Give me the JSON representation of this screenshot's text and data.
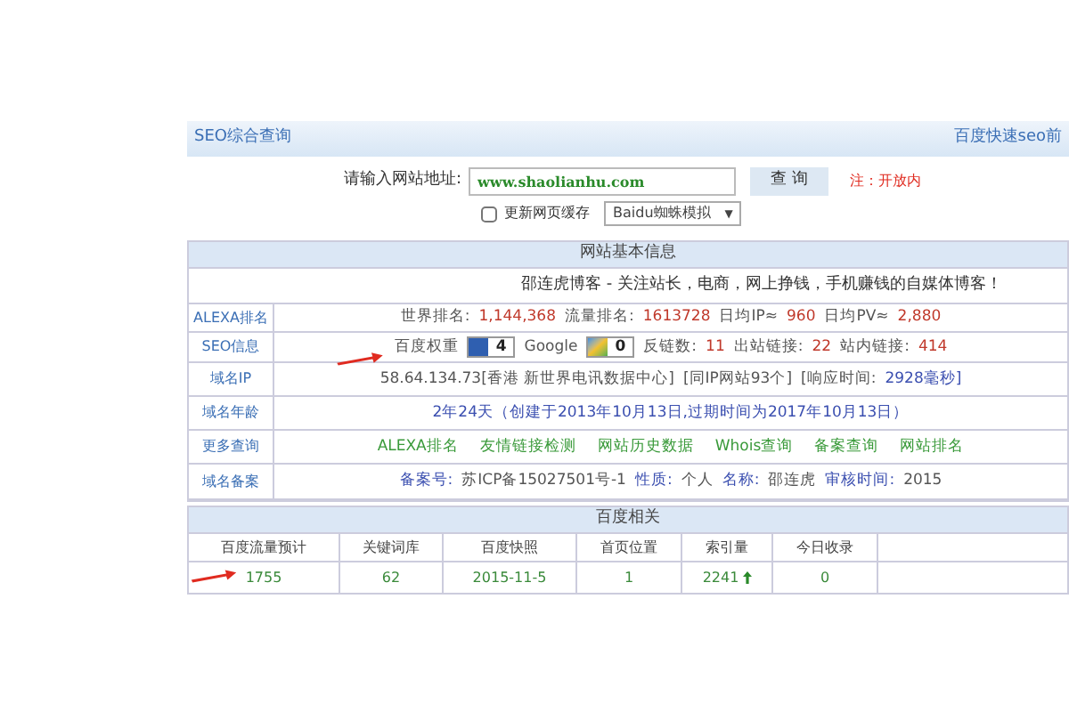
{
  "header": {
    "title": "SEO综合查询",
    "right_link": "百度快速seo前"
  },
  "query": {
    "label": "请输入网站地址:",
    "value": "www.shaolianhu.com",
    "button": "查 询",
    "note": "注：开放内"
  },
  "options": {
    "checkbox_label": "更新网页缓存",
    "checked": false,
    "dropdown": "Baidu蜘蛛模拟",
    "caret": "▼"
  },
  "basic": {
    "title": "网站基本信息",
    "slogan": "邵连虎博客 - 关注站长，电商，网上挣钱，手机赚钱的自媒体博客！",
    "rows": [
      {
        "label": "ALEXA排名",
        "kind": "segments",
        "segments": [
          {
            "text": "世界排名:",
            "kind": "label"
          },
          {
            "text": "1,144,368",
            "kind": "value"
          },
          {
            "text": "流量排名:",
            "kind": "label"
          },
          {
            "text": "1613728",
            "kind": "value"
          },
          {
            "text": "日均IP≈",
            "kind": "label"
          },
          {
            "text": "960",
            "kind": "value"
          },
          {
            "text": "日均PV≈",
            "kind": "label"
          },
          {
            "text": "2,880",
            "kind": "value"
          }
        ]
      },
      {
        "label": "SEO信息",
        "kind": "seo",
        "baidu_label": "百度权重",
        "baidu_value": "4",
        "google_label": "Google",
        "google_value": "0",
        "segments": [
          {
            "text": "反链数:",
            "kind": "label"
          },
          {
            "text": "11",
            "kind": "value"
          },
          {
            "text": "出站链接:",
            "kind": "label"
          },
          {
            "text": "22",
            "kind": "value"
          },
          {
            "text": "站内链接:",
            "kind": "label"
          },
          {
            "text": "414",
            "kind": "value"
          }
        ]
      },
      {
        "label": "域名IP",
        "kind": "segments",
        "segments": [
          {
            "text": "58.64.134.73[香港 新世界电讯数据中心]",
            "kind": "label"
          },
          {
            "text": "[同IP网站93个]",
            "kind": "label"
          },
          {
            "text": "[响应时间:",
            "kind": "label"
          },
          {
            "text": "2928毫秒]",
            "kind": "link"
          }
        ]
      },
      {
        "label": "域名年龄",
        "kind": "segments",
        "segments": [
          {
            "text": "2年24天（创建于2013年10月13日,过期时间为2017年10月13日）",
            "kind": "link"
          }
        ]
      },
      {
        "label": "更多查询",
        "kind": "links",
        "links": [
          "ALEXA排名",
          "友情链接检测",
          "网站历史数据",
          "Whois查询",
          "备案查询",
          "网站排名"
        ]
      },
      {
        "label": "域名备案",
        "kind": "segments",
        "segments": [
          {
            "text": "备案号:",
            "kind": "link"
          },
          {
            "text": "苏ICP备15027501号-1",
            "kind": "label"
          },
          {
            "text": "性质:",
            "kind": "link"
          },
          {
            "text": "个人",
            "kind": "label"
          },
          {
            "text": "名称:",
            "kind": "link"
          },
          {
            "text": "邵连虎",
            "kind": "label"
          },
          {
            "text": "审核时间:",
            "kind": "link"
          },
          {
            "text": "2015",
            "kind": "label"
          }
        ]
      }
    ]
  },
  "baidu": {
    "title": "百度相关",
    "columns": [
      "百度流量预计",
      "关键词库",
      "百度快照",
      "首页位置",
      "索引量",
      "今日收录"
    ],
    "row": [
      {
        "text": "1755",
        "rising": false
      },
      {
        "text": "62",
        "rising": false
      },
      {
        "text": "2015-11-5",
        "rising": false
      },
      {
        "text": "1",
        "rising": false
      },
      {
        "text": "2241",
        "rising": true
      },
      {
        "text": "0",
        "rising": false
      }
    ]
  }
}
